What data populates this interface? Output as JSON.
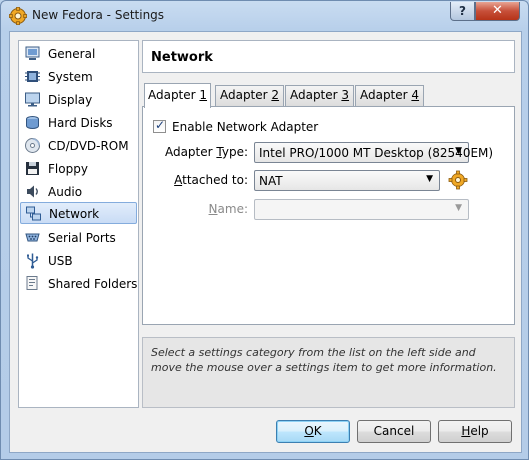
{
  "window": {
    "title": "New Fedora - Settings",
    "help_button": "?",
    "close_button": "✕"
  },
  "sidebar": {
    "items": [
      {
        "label": "General",
        "icon": "general-icon"
      },
      {
        "label": "System",
        "icon": "system-chip-icon"
      },
      {
        "label": "Display",
        "icon": "display-monitor-icon"
      },
      {
        "label": "Hard Disks",
        "icon": "hard-disk-icon"
      },
      {
        "label": "CD/DVD-ROM",
        "icon": "cd-dvd-icon"
      },
      {
        "label": "Floppy",
        "icon": "floppy-icon"
      },
      {
        "label": "Audio",
        "icon": "audio-speaker-icon"
      },
      {
        "label": "Network",
        "icon": "network-icon",
        "selected": true
      },
      {
        "label": "Serial Ports",
        "icon": "serial-port-icon"
      },
      {
        "label": "USB",
        "icon": "usb-icon"
      },
      {
        "label": "Shared Folders",
        "icon": "shared-folder-icon"
      }
    ]
  },
  "page": {
    "title": "Network"
  },
  "tabs": [
    {
      "pre": "Adapter ",
      "key": "1",
      "active": true
    },
    {
      "pre": "Adapter ",
      "key": "2"
    },
    {
      "pre": "Adapter ",
      "key": "3"
    },
    {
      "pre": "Adapter ",
      "key": "4"
    }
  ],
  "adapter": {
    "enable_label": "Enable Network Adapter",
    "enable_checked": true,
    "type_label_pre": "Adapter ",
    "type_label_key": "T",
    "type_label_post": "ype:",
    "type_value": "Intel PRO/1000 MT Desktop (82540EM)",
    "attached_label_key": "A",
    "attached_label_post": "ttached to:",
    "attached_value": "NAT",
    "name_label_key": "N",
    "name_label_post": "ame:",
    "name_value": ""
  },
  "info": {
    "text": "Select a settings category from the list on the left side and move the mouse over a settings item to get more information."
  },
  "buttons": {
    "ok_key": "O",
    "ok_rest": "K",
    "cancel": "Cancel",
    "help_key": "H",
    "help_rest": "elp"
  },
  "colors": {
    "selection": "#c9dcf5",
    "close_button": "#c7503a",
    "default_button": "#bee6fd"
  }
}
